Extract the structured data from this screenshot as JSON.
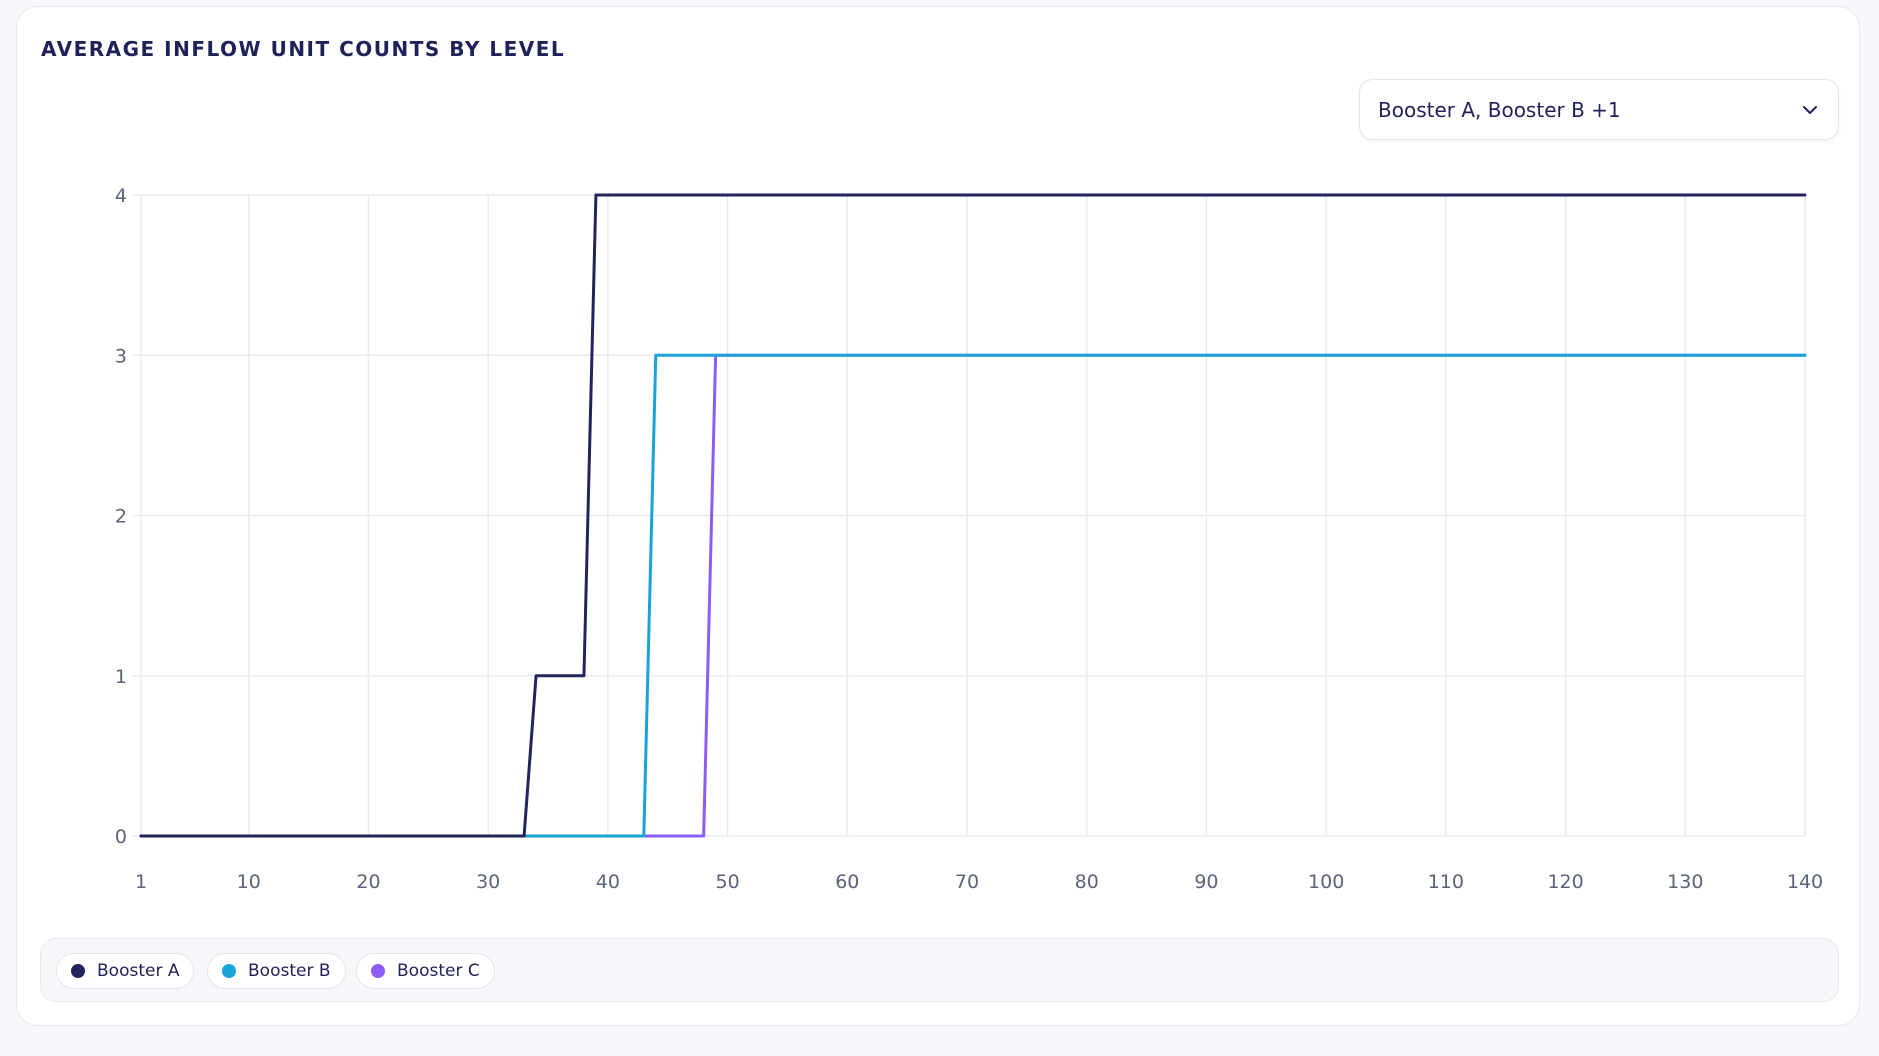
{
  "panel": {
    "title": "AVERAGE INFLOW UNIT COUNTS BY LEVEL"
  },
  "filter": {
    "selected_label": "Booster A, Booster B +1",
    "icon": "chevron-down-icon"
  },
  "colors": {
    "booster_a": "#24245c",
    "booster_b": "#1aa3d9",
    "booster_c": "#8b5cf6",
    "grid": "#e8ebf1",
    "axis_text": "#5b6378"
  },
  "legend": [
    {
      "label": "Booster A",
      "color": "#24245c"
    },
    {
      "label": "Booster B",
      "color": "#1aa3d9"
    },
    {
      "label": "Booster C",
      "color": "#8b5cf6"
    }
  ],
  "chart_data": {
    "type": "line",
    "title": "AVERAGE INFLOW UNIT COUNTS BY LEVEL",
    "xlabel": "",
    "ylabel": "",
    "xlim": [
      1,
      140
    ],
    "ylim": [
      0,
      4
    ],
    "x_ticks": [
      1,
      10,
      20,
      30,
      40,
      50,
      60,
      70,
      80,
      90,
      100,
      110,
      120,
      130,
      140
    ],
    "y_ticks": [
      0,
      1,
      2,
      3,
      4
    ],
    "grid": true,
    "legend_position": "bottom-left",
    "series": [
      {
        "name": "Booster A",
        "color": "#24245c",
        "points": [
          [
            1,
            0
          ],
          [
            33,
            0
          ],
          [
            34,
            1
          ],
          [
            38,
            1
          ],
          [
            39,
            4
          ],
          [
            140,
            4
          ]
        ]
      },
      {
        "name": "Booster B",
        "color": "#1aa3d9",
        "points": [
          [
            1,
            0
          ],
          [
            43,
            0
          ],
          [
            44,
            3
          ],
          [
            140,
            3
          ]
        ]
      },
      {
        "name": "Booster C",
        "color": "#8b5cf6",
        "points": [
          [
            1,
            0
          ],
          [
            48,
            0
          ],
          [
            49,
            3
          ],
          [
            140,
            3
          ]
        ]
      }
    ]
  }
}
